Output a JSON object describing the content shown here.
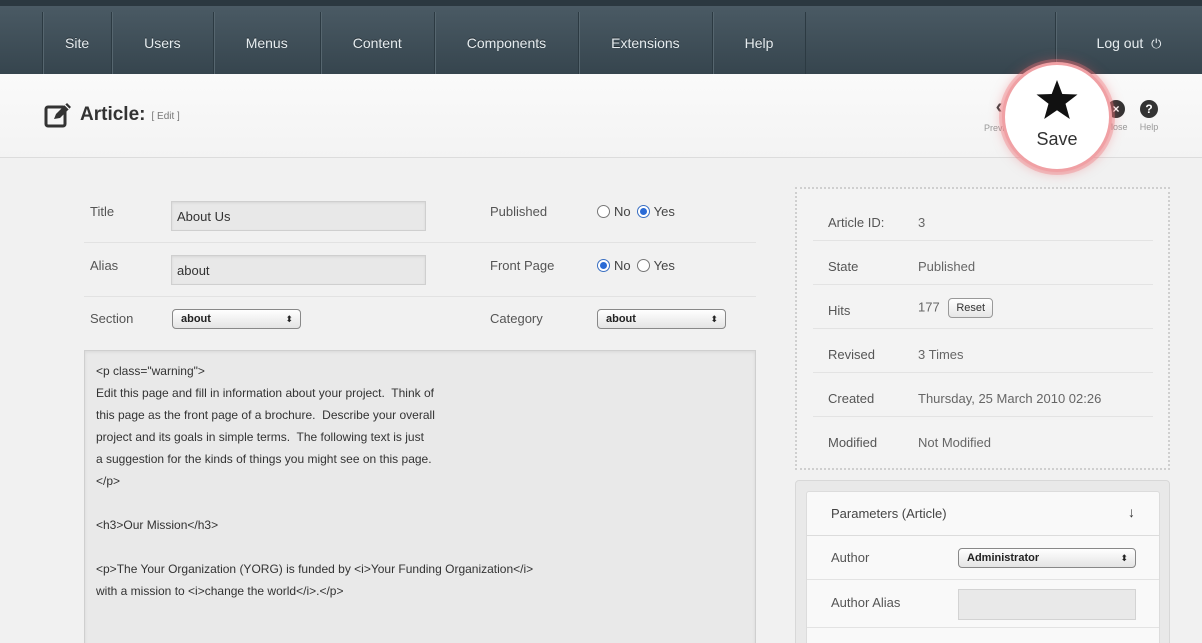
{
  "nav": {
    "items": [
      "Site",
      "Users",
      "Menus",
      "Content",
      "Components",
      "Extensions",
      "Help"
    ],
    "logout_label": "Log out",
    "logout_icon": "power-icon"
  },
  "toolbar": {
    "page_icon": "edit-icon",
    "title": "Article:",
    "subtitle": "[ Edit ]",
    "preview_label": "Preview",
    "save_label": "Save",
    "close_label": "Close",
    "help_label": "Help"
  },
  "form": {
    "title_label": "Title",
    "title_value": "About Us",
    "alias_label": "Alias",
    "alias_value": "about",
    "section_label": "Section",
    "section_value": "about",
    "published_label": "Published",
    "published": {
      "options": [
        "No",
        "Yes"
      ],
      "selected": "Yes"
    },
    "frontpage_label": "Front Page",
    "frontpage": {
      "options": [
        "No",
        "Yes"
      ],
      "selected": "No"
    },
    "category_label": "Category",
    "category_value": "about"
  },
  "editor": {
    "lines": [
      "<p class=\"warning\">",
      "Edit this page and fill in information about your project.  Think of",
      "this page as the front page of a brochure.  Describe your overall",
      "project and its goals in simple terms.  The following text is just",
      "a suggestion for the kinds of things you might see on this page.",
      "</p>",
      "",
      "<h3>Our Mission</h3>",
      "",
      "<p>The Your Organization (YORG) is funded by <i>Your Funding Organization</i>",
      "with a mission to <i>change the world</i>.</p>"
    ]
  },
  "info": {
    "rows": [
      {
        "key": "Article ID:",
        "value": "3"
      },
      {
        "key": "State",
        "value": "Published"
      },
      {
        "key": "Hits",
        "value": "177"
      },
      {
        "key": "Revised",
        "value": "3 Times"
      },
      {
        "key": "Created",
        "value": "Thursday, 25 March 2010 02:26"
      },
      {
        "key": "Modified",
        "value": "Not Modified"
      }
    ],
    "reset_label": "Reset"
  },
  "params": {
    "title": "Parameters (Article)",
    "author_label": "Author",
    "author_value": "Administrator",
    "author_alias_label": "Author Alias",
    "author_alias_value": ""
  }
}
